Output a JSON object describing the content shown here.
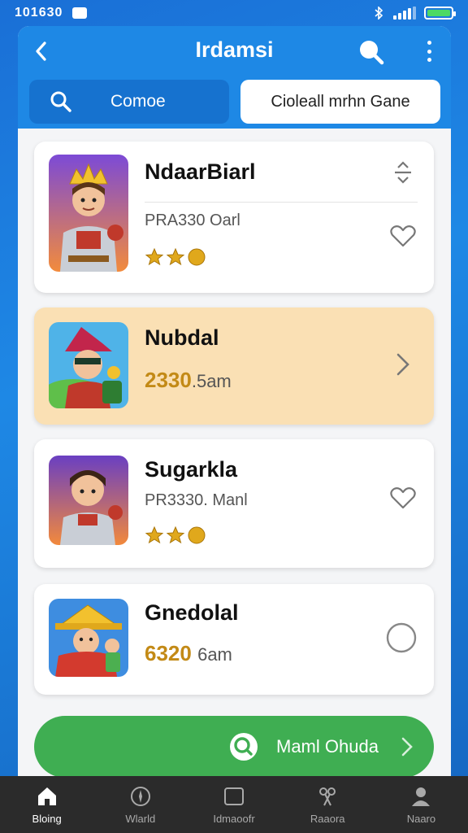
{
  "status_bar": {
    "time": "101630"
  },
  "header": {
    "title": "Irdamsi",
    "tabs": [
      {
        "label": "Comoe"
      },
      {
        "label": "Cioleall mrhn Gane"
      }
    ]
  },
  "cards": [
    {
      "name": "NdaarBiarl",
      "subtitle": "PRA330 Oarl",
      "rating_stars": 3,
      "action_icon": "sort-icon",
      "action_icon2": "heart-icon"
    },
    {
      "name": "Nubdal",
      "value": "2330",
      "unit": ".5am",
      "action_icon": "chevron-right-icon"
    },
    {
      "name": "Sugarkla",
      "subtitle": "PR3330. Manl",
      "rating_stars": 3,
      "action_icon": "heart-icon"
    },
    {
      "name": "Gnedolal",
      "value": "6320",
      "unit": "6am",
      "action_icon": "circle-icon"
    }
  ],
  "cta": {
    "label": "Maml Ohuda",
    "icon": "search-icon"
  },
  "bottom_nav": [
    {
      "label": "Bloing",
      "icon": "home-icon",
      "active": true
    },
    {
      "label": "Wlarld",
      "icon": "compass-icon",
      "active": false
    },
    {
      "label": "Idmaoofr",
      "icon": "square-icon",
      "active": false
    },
    {
      "label": "Raaora",
      "icon": "scissors-icon",
      "active": false
    },
    {
      "label": "Naaro",
      "icon": "user-icon",
      "active": false
    }
  ],
  "colors": {
    "primary": "#1e88e5",
    "highlight_card": "#fae0b4",
    "cta_green": "#3fae52",
    "gold": "#c38a16"
  }
}
